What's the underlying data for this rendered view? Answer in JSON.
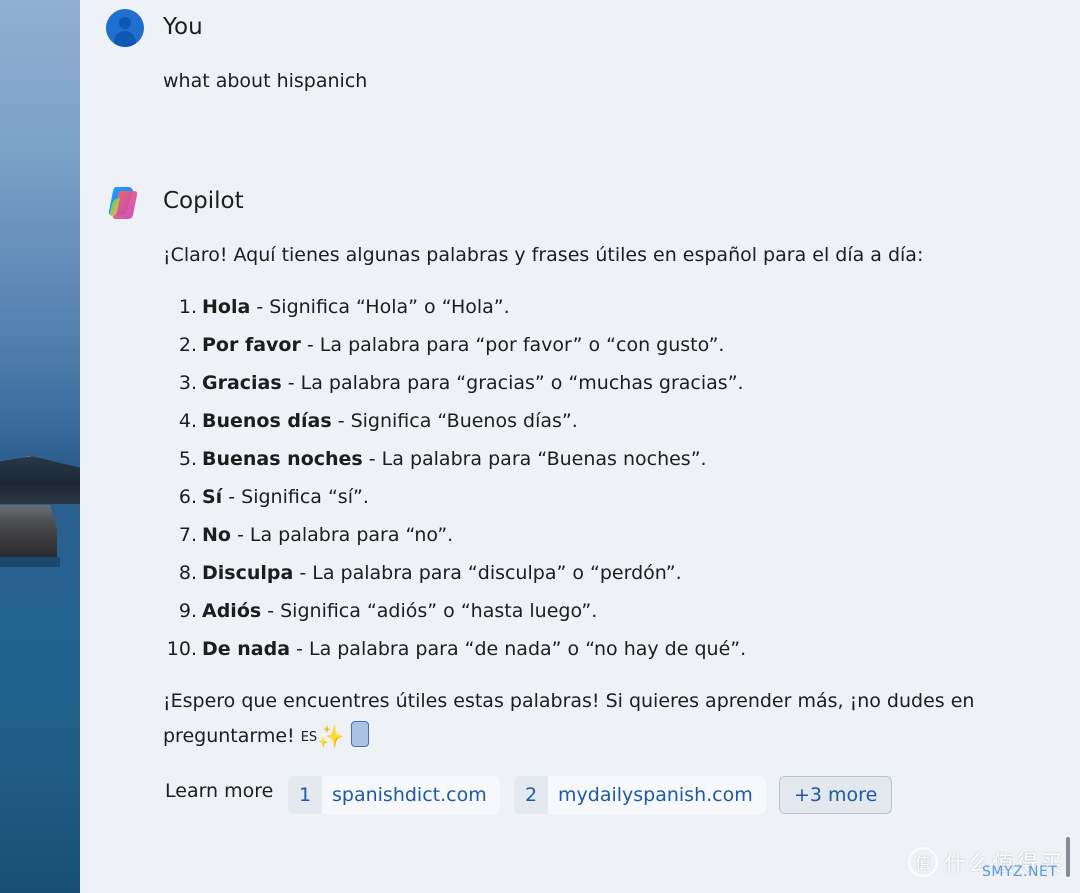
{
  "user": {
    "name": "You",
    "message": "what about hispanich"
  },
  "copilot": {
    "name": "Copilot",
    "intro": "¡Claro! Aquí tienes algunas palabras y frases útiles en español para el día a día:",
    "items": [
      {
        "num": "1.",
        "term": "Hola",
        "desc": " - Significa “Hola” o “Hola”."
      },
      {
        "num": "2.",
        "term": "Por favor",
        "desc": " - La palabra para “por favor” o “con gusto”."
      },
      {
        "num": "3.",
        "term": "Gracias",
        "desc": " - La palabra para “gracias” o “muchas gracias”."
      },
      {
        "num": "4.",
        "term": "Buenos días",
        "desc": " - Significa “Buenos días”."
      },
      {
        "num": "5.",
        "term": "Buenas noches",
        "desc": " - La palabra para “Buenas noches”."
      },
      {
        "num": "6.",
        "term": "Sí",
        "desc": " - Significa “sí”."
      },
      {
        "num": "7.",
        "term": "No",
        "desc": " - La palabra para “no”."
      },
      {
        "num": "8.",
        "term": "Disculpa",
        "desc": " - La palabra para “disculpa” o “perdón”."
      },
      {
        "num": "9.",
        "term": "Adiós",
        "desc": " - Significa “adiós” o “hasta luego”."
      },
      {
        "num": "10.",
        "term": "De nada",
        "desc": " - La palabra para “de nada” o “no hay de qué”."
      }
    ],
    "outro": "¡Espero que encuentres útiles estas palabras! Si quieres aprender más, ¡no dudes en preguntarme! ",
    "flag_text": "ES",
    "sparkle": "✨"
  },
  "sources": {
    "label": "Learn more",
    "chips": [
      {
        "index": "1",
        "host": "spanishdict.com"
      },
      {
        "index": "2",
        "host": "mydailyspanish.com"
      }
    ],
    "more": "+3 more"
  },
  "watermark": {
    "glyph": "值",
    "text": "什么值得买",
    "url": "SMYZ.NET"
  },
  "icons": {
    "avatar": "user-avatar-icon",
    "copilot": "copilot-logo-icon",
    "phone": "phone-icon"
  },
  "colors": {
    "avatar": "#1f6fcf",
    "link": "#1c5aa6",
    "panel": "#eef1f6"
  }
}
